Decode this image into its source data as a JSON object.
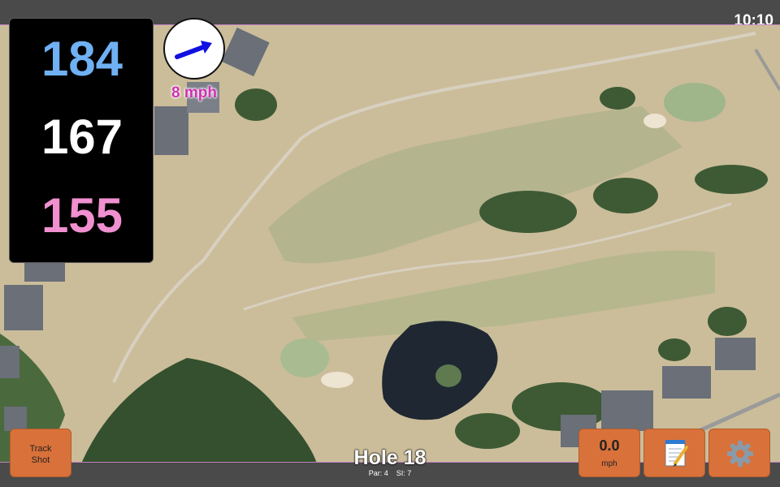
{
  "clock": "10:10",
  "distances": {
    "back": "184",
    "middle": "167",
    "front": "155",
    "colors": {
      "back": "#6fb1f2",
      "middle": "#ffffff",
      "front": "#f090d0"
    }
  },
  "wind": {
    "speed_label": "8 mph",
    "arrow_color": "#1010e0"
  },
  "hole": {
    "title": "Hole 18",
    "par": "Par: 4",
    "si": "SI: 7"
  },
  "buttons": {
    "track_shot": [
      "Track",
      "Shot"
    ],
    "speed_value": "0.0",
    "speed_unit": "mph",
    "notes_icon": "notepad-icon",
    "settings_icon": "gear-icon"
  },
  "colors": {
    "button": "#d9713a",
    "panel": "#000000",
    "bars": "#4a4a4a"
  }
}
